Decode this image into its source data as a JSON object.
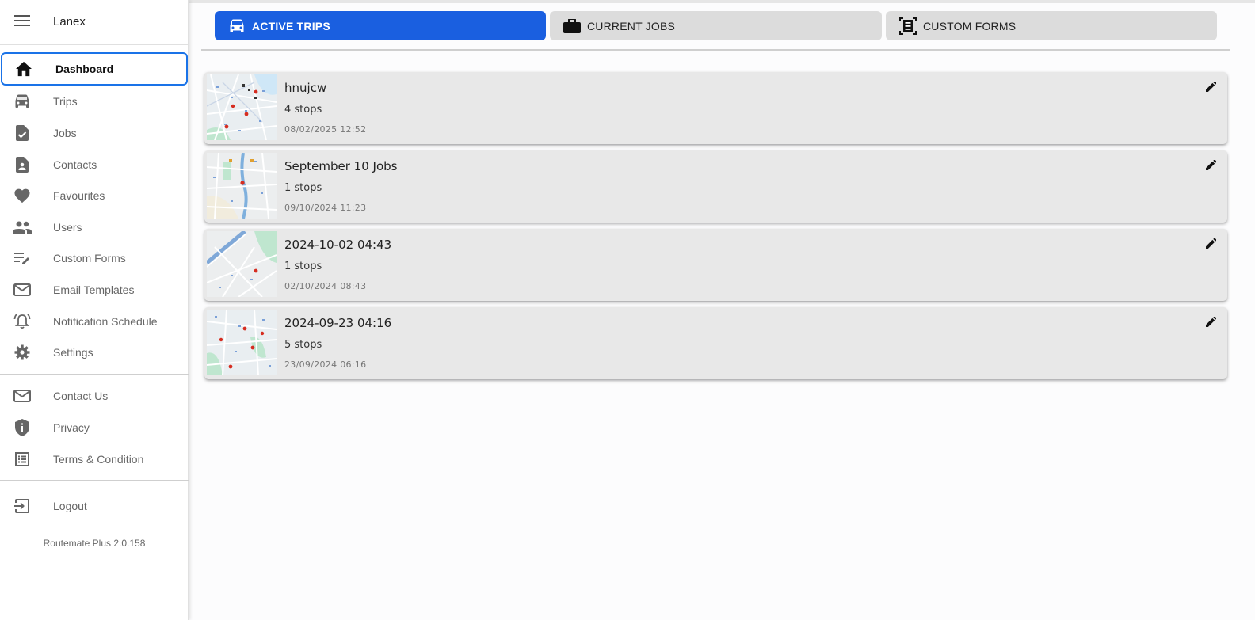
{
  "app": {
    "brand": "Lanex",
    "version": "Routemate Plus 2.0.158"
  },
  "colors": {
    "accent": "#1a5fe0",
    "active_border": "#1a73e8",
    "card_bg": "#e8e8e8",
    "tab_bg": "#dcdcdc"
  },
  "sidebar": {
    "menu_icon": "hamburger-icon",
    "main_items": [
      {
        "label": "Dashboard",
        "icon": "home-icon",
        "active": true
      },
      {
        "label": "Trips",
        "icon": "car-icon"
      },
      {
        "label": "Jobs",
        "icon": "task-file-icon"
      },
      {
        "label": "Contacts",
        "icon": "contact-file-icon"
      },
      {
        "label": "Favourites",
        "icon": "heart-icon"
      },
      {
        "label": "Users",
        "icon": "people-icon"
      },
      {
        "label": "Custom Forms",
        "icon": "edit-list-icon"
      },
      {
        "label": "Email Templates",
        "icon": "mail-icon"
      },
      {
        "label": "Notification Schedule",
        "icon": "alarm-bell-icon"
      },
      {
        "label": "Settings",
        "icon": "gear-icon"
      }
    ],
    "secondary_items": [
      {
        "label": "Contact Us",
        "icon": "mail-icon"
      },
      {
        "label": "Privacy",
        "icon": "shield-icon"
      },
      {
        "label": "Terms & Condition",
        "icon": "list-icon"
      }
    ],
    "logout": {
      "label": "Logout",
      "icon": "logout-icon"
    }
  },
  "tabs": [
    {
      "label": "ACTIVE TRIPS",
      "icon": "car-icon",
      "active": true
    },
    {
      "label": "CURRENT JOBS",
      "icon": "briefcase-icon"
    },
    {
      "label": "CUSTOM FORMS",
      "icon": "form-icon"
    }
  ],
  "trips": [
    {
      "title": "hnujcw",
      "stops": "4 stops",
      "date": "08/02/2025 12:52"
    },
    {
      "title": "September 10 Jobs",
      "stops": "1 stops",
      "date": "09/10/2024 11:23"
    },
    {
      "title": "2024-10-02 04:43",
      "stops": "1 stops",
      "date": "02/10/2024 08:43"
    },
    {
      "title": "2024-09-23 04:16",
      "stops": "5 stops",
      "date": "23/09/2024 06:16"
    }
  ]
}
